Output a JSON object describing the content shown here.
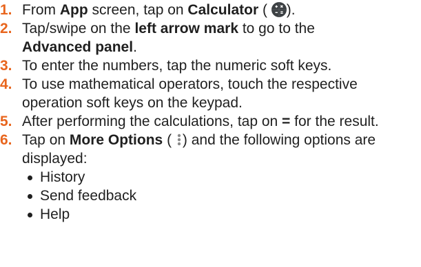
{
  "steps": [
    {
      "num": "1.",
      "t1": "From ",
      "b1": "App",
      "t2": " screen, tap on ",
      "b2": "Calculator",
      "t3": " (",
      "icon": "calculator-app-icon",
      "t4": ")."
    },
    {
      "num": "2.",
      "t1": "Tap/swipe on the ",
      "b1": "left arrow mark",
      "t2": " to go to the ",
      "b2": "Advanced panel",
      "t3": "."
    },
    {
      "num": "3.",
      "t1": "To enter the numbers, tap the numeric soft keys."
    },
    {
      "num": "4.",
      "t1": "To use mathematical operators, touch the respective operation soft keys on the keypad."
    },
    {
      "num": "5.",
      "t1": "After performing the calculations, tap on ",
      "b1": "=",
      "t2": " for the result."
    },
    {
      "num": "6.",
      "t1": "Tap on ",
      "b1": "More Options",
      "t2": " (",
      "icon": "more-options-icon",
      "t3": ") and the following options are displayed:",
      "options": [
        "History",
        "Send feedback",
        "Help"
      ]
    }
  ],
  "colors": {
    "number": "#e8651d",
    "text": "#1f1f1f",
    "calc_icon_bg": "#3c4043"
  }
}
